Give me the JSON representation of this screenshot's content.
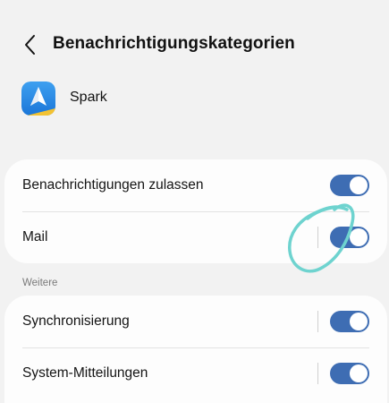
{
  "header": {
    "title": "Benachrichtigungskategorien"
  },
  "app": {
    "name": "Spark",
    "icon": "spark-app-icon"
  },
  "main_card": {
    "rows": [
      {
        "label": "Benachrichtigungen zulassen",
        "enabled": true
      },
      {
        "label": "Mail",
        "enabled": true
      }
    ]
  },
  "section": {
    "label": "Weitere"
  },
  "more_card": {
    "rows": [
      {
        "label": "Synchronisierung",
        "enabled": true
      },
      {
        "label": "System-Mitteilungen",
        "enabled": true
      }
    ]
  },
  "colors": {
    "toggle_on": "#3e6db3",
    "scribble": "#6ed3cf",
    "background": "#f2f2f2"
  }
}
